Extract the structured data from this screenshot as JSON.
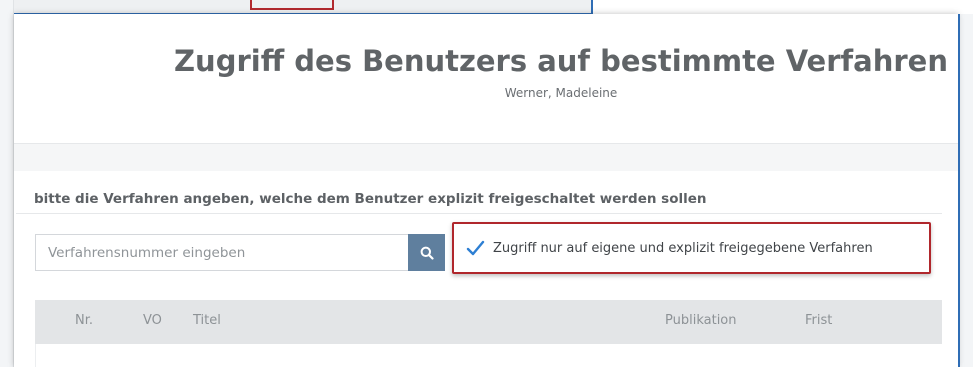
{
  "dialog": {
    "title": "Zugriff des Benutzers auf bestimmte Verfahren",
    "subtitle": "Werner, Madeleine",
    "instruction": "bitte die Verfahren angeben, welche dem Benutzer explizit freigeschaltet werden sollen"
  },
  "search": {
    "placeholder": "Verfahrensnummer eingeben",
    "button_icon": "search-icon"
  },
  "access_option": {
    "label": "Zugriff nur auf eigene und explizit freigegebene Verfahren",
    "checked": true,
    "highlight_color": "#b0272c"
  },
  "table": {
    "columns": [
      "Nr.",
      "VO",
      "Titel",
      "Publikation",
      "Frist"
    ]
  },
  "colors": {
    "accent_button": "#5f7f9e",
    "window_border": "#2f6db5"
  }
}
